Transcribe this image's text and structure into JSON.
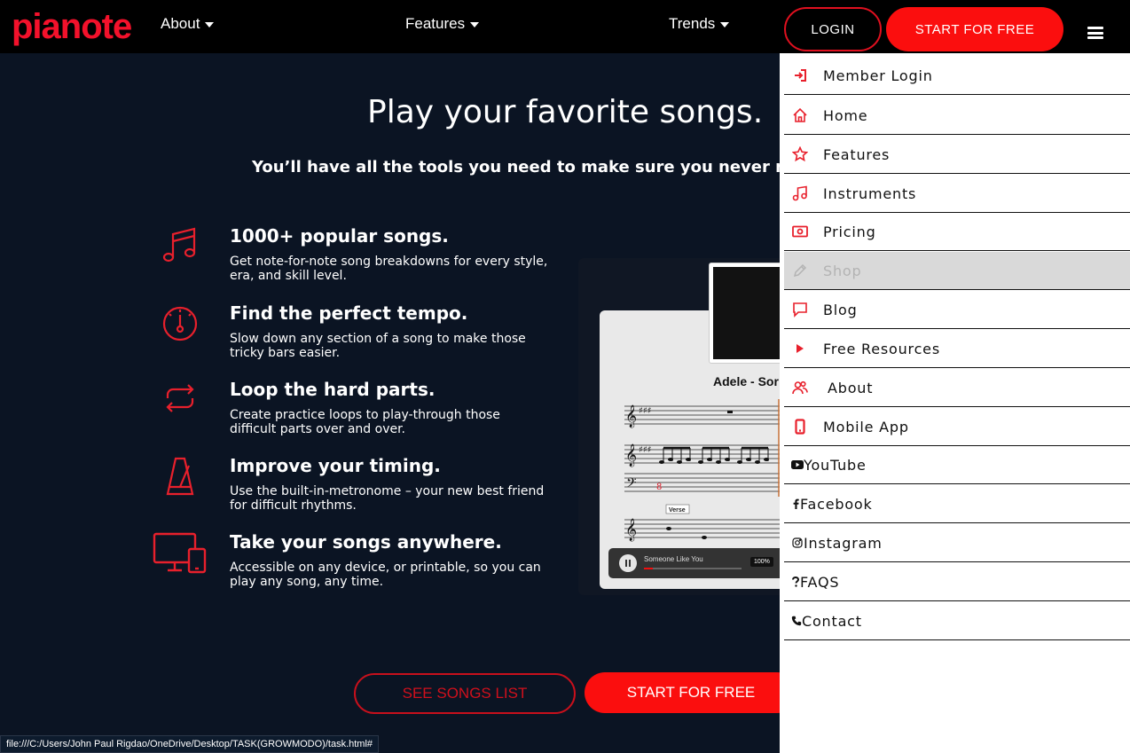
{
  "brand": {
    "logo_text": "pianote",
    "accent": "#f3112b"
  },
  "nav": {
    "links": [
      {
        "label": "About"
      },
      {
        "label": "Features"
      },
      {
        "label": "Trends"
      }
    ],
    "login_label": "LOGIN",
    "start_label": "START FOR FREE"
  },
  "hero": {
    "title": "Play your favorite songs.",
    "subtitle": "You’ll have all the tools you need to make sure you never m"
  },
  "features": [
    {
      "icon": "music-notes-icon",
      "title": "1000+ popular songs.",
      "desc": "Get note-for-note song breakdowns for every style, era, and skill level."
    },
    {
      "icon": "tempo-dial-icon",
      "title": "Find the perfect tempo.",
      "desc": "Slow down any section of a song to make those tricky bars easier."
    },
    {
      "icon": "loop-icon",
      "title": "Loop the hard parts.",
      "desc": "Create practice loops to play-through those difficult parts over and over."
    },
    {
      "icon": "metronome-icon",
      "title": "Improve your timing.",
      "desc": "Use the built-in-metronome – your new best friend for difficult rhythms."
    },
    {
      "icon": "devices-icon",
      "title": "Take your songs anywhere.",
      "desc": "Accessible on any device, or printable, so you can play any song, any time."
    }
  ],
  "preview": {
    "sheet_title": "Adele - Sor",
    "section_label": "Verse",
    "player_title": "Someone Like You",
    "zoom": "100%"
  },
  "cta": {
    "songs_label": "SEE SONGS LIST",
    "start_label": "START FOR FREE"
  },
  "status_url": "file:///C:/Users/John Paul Rigdao/OneDrive/Desktop/TASK(GROWMODO)/task.html#",
  "menu": [
    {
      "label": "Member Login",
      "icon": "login-icon"
    },
    {
      "label": "Home",
      "icon": "home-icon"
    },
    {
      "label": "Features",
      "icon": "star-icon"
    },
    {
      "label": "Instruments",
      "icon": "music-note-icon"
    },
    {
      "label": "Pricing",
      "icon": "money-icon"
    },
    {
      "label": "Shop",
      "icon": "pencil-icon",
      "disabled": true
    },
    {
      "label": "Blog",
      "icon": "comment-icon"
    },
    {
      "label": "Free Resources",
      "icon": "play-icon"
    },
    {
      "label": "About",
      "icon": "users-icon"
    },
    {
      "label": "Mobile App",
      "icon": "mobile-icon"
    },
    {
      "label": "YouTube",
      "icon": "youtube-icon"
    },
    {
      "label": "Facebook",
      "icon": "facebook-icon"
    },
    {
      "label": "Instagram",
      "icon": "instagram-icon"
    },
    {
      "label": "FAQS",
      "icon": "question-icon"
    },
    {
      "label": "Contact",
      "icon": "phone-icon"
    }
  ]
}
